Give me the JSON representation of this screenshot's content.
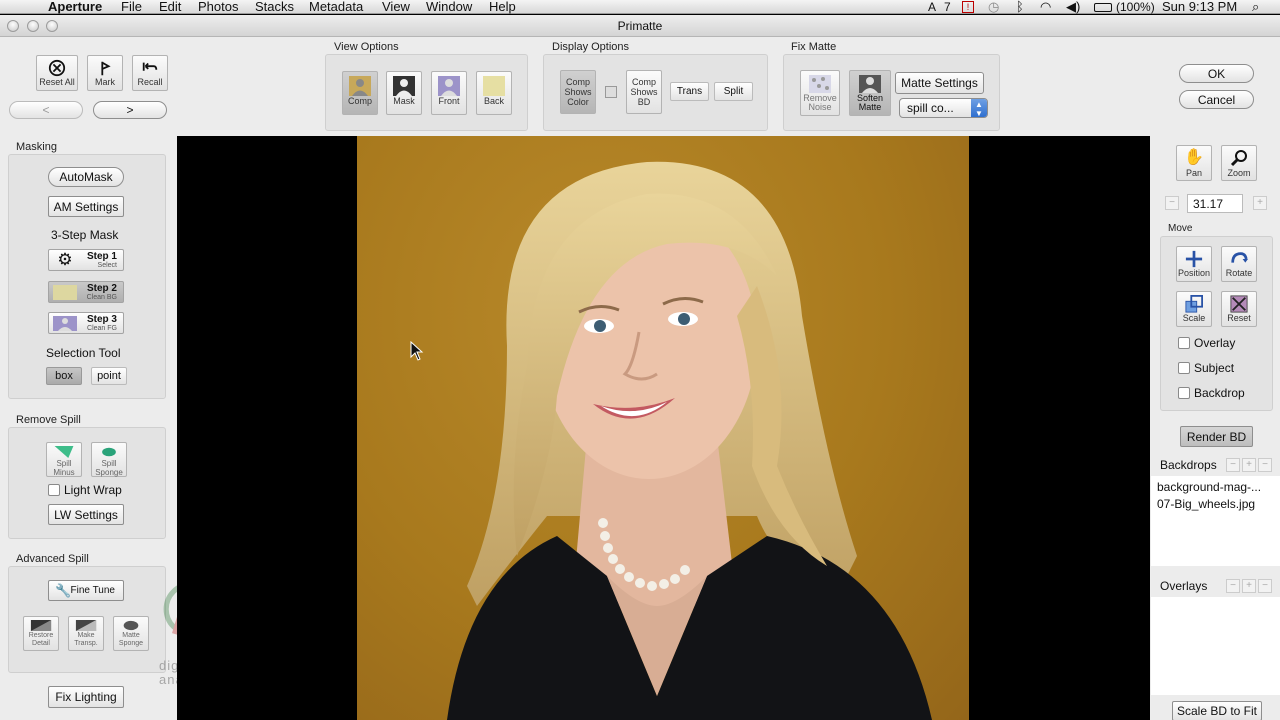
{
  "menubar": {
    "app": "Aperture",
    "items": [
      "File",
      "Edit",
      "Photos",
      "Stacks",
      "Metadata",
      "View",
      "Window",
      "Help"
    ],
    "status": {
      "count": "7",
      "battery": "(100%)",
      "clock": "Sun 9:13 PM"
    }
  },
  "window": {
    "title": "Primatte"
  },
  "toolbar": {
    "reset_all": "Reset All",
    "mark": "Mark",
    "recall": "Recall",
    "prev": "<",
    "next": ">"
  },
  "view_options": {
    "title": "View Options",
    "buttons": [
      "Comp",
      "Mask",
      "Front",
      "Back"
    ]
  },
  "display_options": {
    "title": "Display Options",
    "comp_shows_color": "Comp Shows Color",
    "comp_shows_bd": "Comp Shows BD",
    "trans": "Trans",
    "split": "Split"
  },
  "fix_matte": {
    "title": "Fix Matte",
    "remove_noise": "Remove Noise",
    "soften_matte": "Soften Matte",
    "matte_settings": "Matte Settings",
    "spill_select": "spill co..."
  },
  "dialog": {
    "ok": "OK",
    "cancel": "Cancel"
  },
  "masking": {
    "title": "Masking",
    "automask": "AutoMask",
    "am_settings": "AM Settings",
    "three_step": "3-Step Mask",
    "step1": {
      "title": "Step 1",
      "sub": "Select"
    },
    "step2": {
      "title": "Step 2",
      "sub": "Clean BG"
    },
    "step3": {
      "title": "Step 3",
      "sub": "Clean FG"
    },
    "selection_tool": "Selection Tool",
    "box": "box",
    "point": "point"
  },
  "remove_spill": {
    "title": "Remove Spill",
    "spill_minus": "Spill Minus",
    "spill_sponge": "Spill Sponge",
    "light_wrap": "Light Wrap",
    "lw_settings": "LW Settings"
  },
  "advanced_spill": {
    "title": "Advanced Spill",
    "fine_tune": "Fine Tune",
    "restore_detail": "Restore Detail",
    "make_transp": "Make Transp.",
    "matte_sponge": "Matte Sponge"
  },
  "fix_lighting": "Fix Lighting",
  "watermark": {
    "line1": "digital",
    "line2": "anarchy"
  },
  "right_panel": {
    "pan": "Pan",
    "zoom": "Zoom",
    "zoom_value": "31.17",
    "move_title": "Move",
    "position": "Position",
    "rotate": "Rotate",
    "scale": "Scale",
    "reset": "Reset",
    "overlay": "Overlay",
    "subject": "Subject",
    "backdrop": "Backdrop",
    "render_bd": "Render BD",
    "backdrops_title": "Backdrops",
    "backdrops": [
      "background-mag-...",
      "07-Big_wheels.jpg"
    ],
    "overlays_title": "Overlays",
    "scale_bd_to_fit": "Scale BD to Fit"
  },
  "colors": {
    "backdrop_gold": "#a8791d",
    "canvas": "#000000",
    "panel": "#ececec"
  }
}
